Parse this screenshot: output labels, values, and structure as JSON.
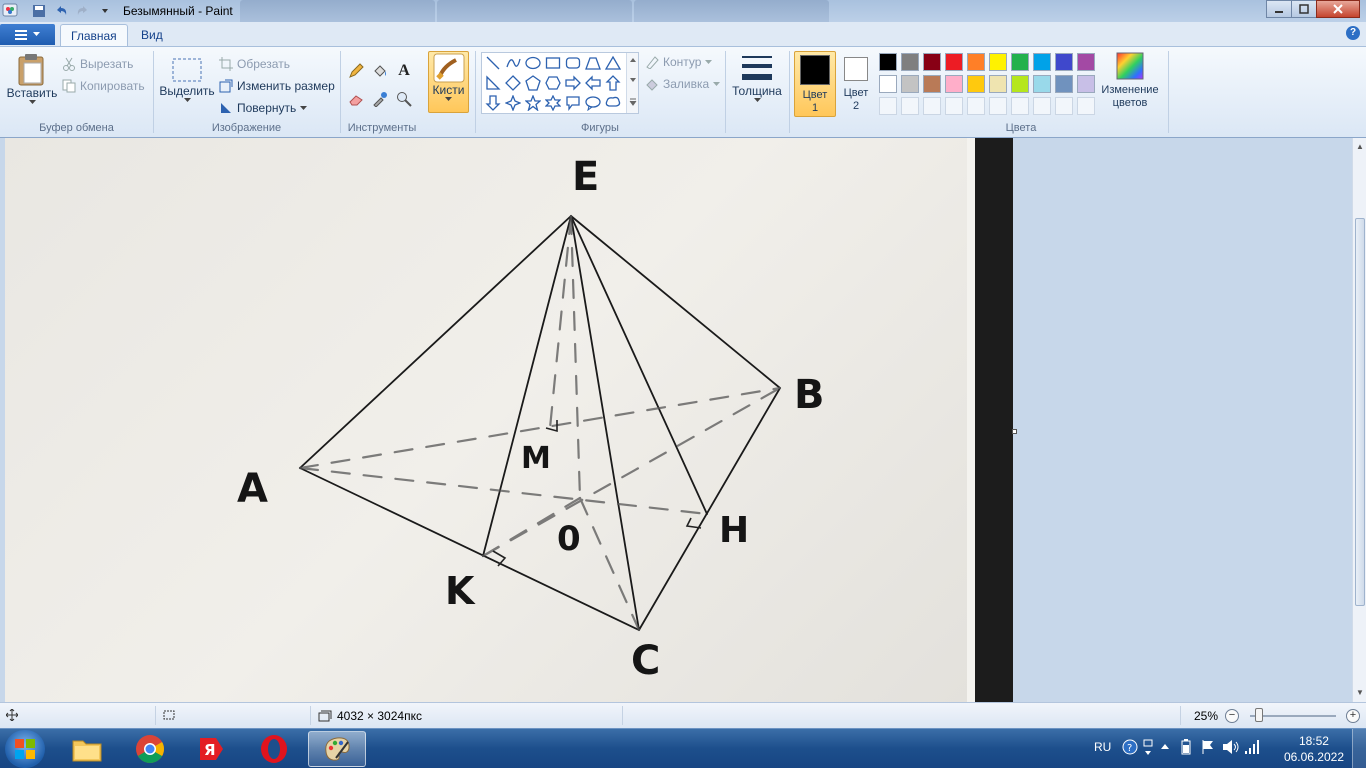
{
  "window": {
    "title": "Безымянный - Paint"
  },
  "tabs": {
    "home": "Главная",
    "view": "Вид"
  },
  "clipboard": {
    "paste": "Вставить",
    "cut": "Вырезать",
    "copy": "Копировать",
    "group": "Буфер обмена"
  },
  "image": {
    "select": "Выделить",
    "crop": "Обрезать",
    "resize": "Изменить размер",
    "rotate": "Повернуть",
    "group": "Изображение"
  },
  "tools": {
    "group": "Инструменты",
    "brushes": "Кисти"
  },
  "shapes": {
    "outline": "Контур",
    "fill": "Заливка",
    "group": "Фигуры"
  },
  "size": {
    "label": "Толщина"
  },
  "colors": {
    "color1": "Цвет 1",
    "color2": "Цвет 2",
    "edit": "Изменение цветов",
    "group": "Цвета",
    "palette_row1": [
      "#000000",
      "#7f7f7f",
      "#880015",
      "#ed1c24",
      "#ff7f27",
      "#fff200",
      "#22b14c",
      "#00a2e8",
      "#3f48cc",
      "#a349a4"
    ],
    "palette_row2": [
      "#ffffff",
      "#c3c3c3",
      "#b97a57",
      "#ffaec9",
      "#ffc90e",
      "#efe4b0",
      "#b5e61d",
      "#99d9ea",
      "#7092be",
      "#c8bfe7"
    ],
    "color1_value": "#000000",
    "color2_value": "#ffffff"
  },
  "drawing": {
    "labels": {
      "E": "E",
      "B": "B",
      "A": "A",
      "M": "M",
      "H": "H",
      "O": "0",
      "K": "K",
      "C": "C"
    }
  },
  "status": {
    "dimensions": "4032 × 3024пкс",
    "zoom": "25%"
  },
  "taskbar": {
    "lang": "RU",
    "time": "18:52",
    "date": "06.06.2022"
  }
}
